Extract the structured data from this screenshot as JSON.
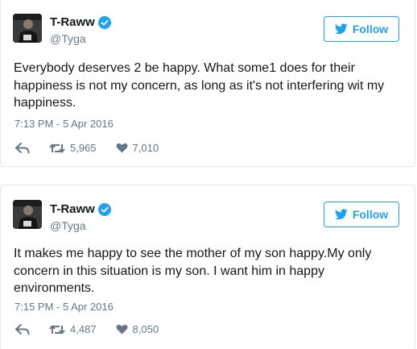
{
  "tweets": [
    {
      "name": "T-Raww",
      "handle": "@Tyga",
      "follow_label": "Follow",
      "text": "Everybody deserves 2 be happy. What some1 does for their happiness is not my concern, as long as it's not interfering wit my happiness.",
      "timestamp": "7:13 PM - 5 Apr 2016",
      "retweets": "5,965",
      "likes": "7,010"
    },
    {
      "name": "T-Raww",
      "handle": "@Tyga",
      "follow_label": "Follow",
      "text": "It makes me happy to see the mother of my son happy.My only concern in this situation is my son. I want him in happy environments.",
      "timestamp": "7:15 PM - 5 Apr 2016",
      "retweets": "4,487",
      "likes": "8,050"
    }
  ],
  "colors": {
    "accent": "#1da1f2",
    "secondary_text": "#657786",
    "border": "#e1e8ed"
  },
  "icons": [
    "verified-icon",
    "twitter-bird-icon",
    "reply-icon",
    "retweet-icon",
    "heart-icon"
  ]
}
